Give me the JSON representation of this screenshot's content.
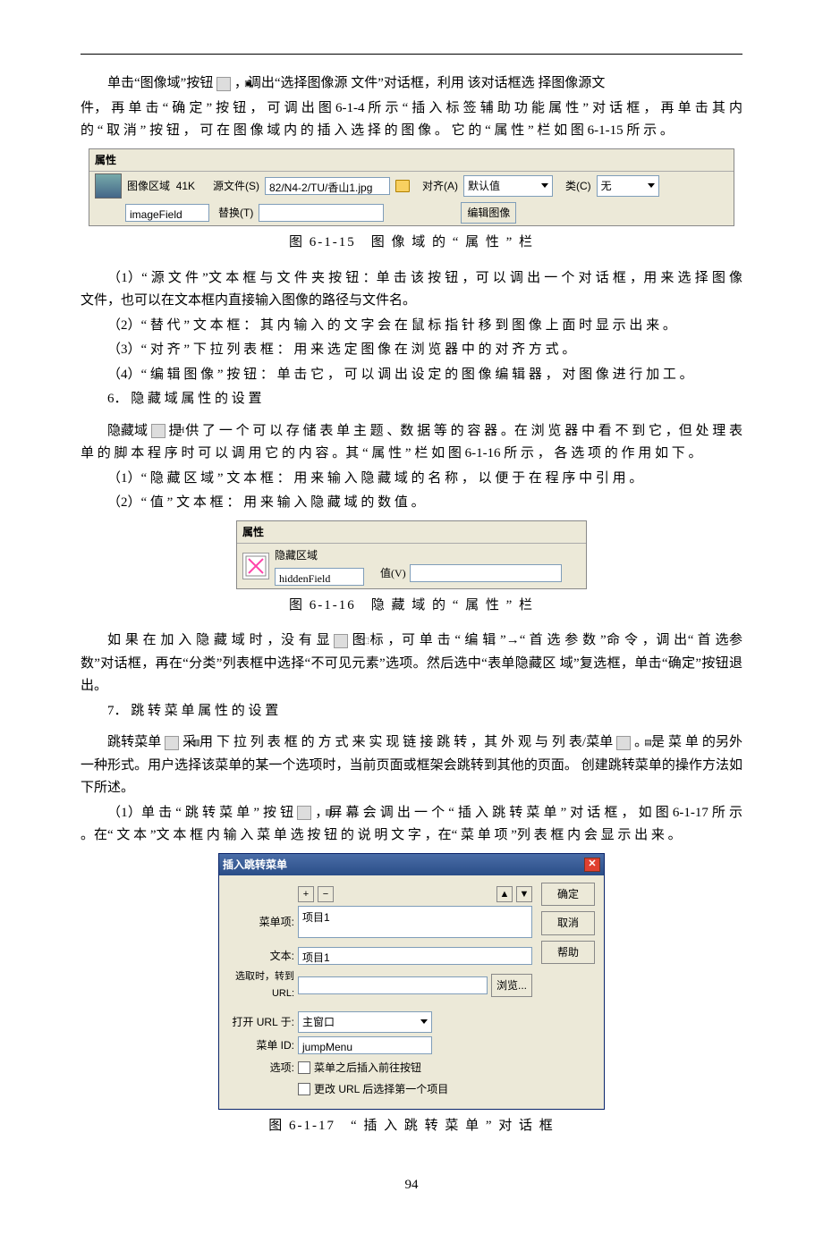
{
  "para1a": "单击“图像域”按钮",
  "para1b": "，调出“选择图像源 文件”对话框，利用 该对话框选 择图像源文",
  "para1c": "件， 再 单 击 “ 确 定 ” 按 钮 ， 可 调 出 图 6-1-4 所 示 “ 插 入 标 签 辅 助 功 能 属 性 ” 对 话 框 ， 再 单 击 其 内 的 “ 取 消 ” 按 钮 ， 可 在 图 像 域 内 的 插 入 选 择 的 图 像 。 它 的 “ 属 性 ” 栏 如 图 6-1-15 所 示 。",
  "panel15": {
    "tab": "属性",
    "label_area": "图像区域",
    "size": "41K",
    "src_label": "源文件(S)",
    "src_value": "82/N4-2/TU/香山1.jpg",
    "align_label": "对齐(A)",
    "align_value": "默认值",
    "class_label": "类(C)",
    "class_value": "无",
    "name_value": "imageField",
    "alt_label": "替换(T)",
    "edit_img_btn": "编辑图像"
  },
  "caption15": "图 6-1-15　图 像 域 的 “ 属 性 ” 栏",
  "para2": "（1）“ 源 文 件 ”文 本 框 与 文 件 夹 按 钮 ：单 击 该 按 钮 ，可 以 调 出 一 个 对 话 框 ，用 来 选 择 图 像 文件，也可以在文本框内直接输入图像的路径与文件名。",
  "para3": "（2）“ 替 代 ” 文 本 框 ： 其 内 输 入 的 文 字 会 在 鼠 标 指 针 移 到 图 像 上 面 时 显 示 出 来 。",
  "para4": "（3）“ 对 齐 ” 下 拉 列 表 框 ： 用 来 选 定 图 像 在 浏 览 器 中 的 对 齐 方 式 。",
  "para5": "（4）“ 编 辑 图 像 ” 按 钮 ： 单 击 它 ， 可 以 调 出 设 定 的 图 像 编 辑 器 ， 对 图 像 进 行 加 工 。",
  "sec6": "6． 隐 藏 域 属 性 的 设 置",
  "para6a": "隐藏域",
  "para6b": "提 供 了 一 个 可 以 存 储 表 单 主 题 、数 据 等 的 容 器 。在 浏 览 器 中 看 不 到 它 ，但 处 理 表 单 的 脚 本 程 序 时 可 以 调 用 它 的 内 容 。其 “ 属 性 ” 栏 如 图 6-1-16 所 示 ， 各 选 项 的 作 用 如 下 。",
  "para7": "（1）“ 隐 藏 区 域 ” 文 本 框 ： 用 来 输 入 隐 藏 域 的 名 称 ， 以 便 于 在 程 序 中 引 用 。",
  "para8": "（2）“ 值 ” 文 本 框 ： 用 来 输 入 隐 藏 域 的 数 值 。",
  "panel16": {
    "tab": "属性",
    "label": "隐藏区域",
    "name_value": "hiddenField",
    "val_label": "值(V)"
  },
  "caption16": "图 6-1-16　隐 藏 域 的 “ 属 性 ” 栏",
  "para9a": "如 果 在 加 入 隐 藏 域 时 ，没 有 显",
  "para9b": "图 标 ，可 单 击 “ 编 辑 ”→“ 首 选 参 数 ”命 令 ，调 出“ 首 选参数”对话框，再在“分类”列表框中选择“不可见元素”选项。然后选中“表单隐藏区 域”复选框，单击“确定”按钮退出。",
  "sec7": "7． 跳 转 菜 单 属 性 的 设 置",
  "para10a": "跳转菜单",
  "para10b": "采 用 下 拉 列 表 框 的 方 式 来 实 现 链 接 跳 转 ，其 外 观 与 列 表/菜单",
  "para10c": "。 是 菜 单 的另外一种形式。用户选择该菜单的某一个选项时，当前页面或框架会跳转到其他的页面。 创建跳转菜单的操作方法如下所述。",
  "para11a": "（1）单 击 “ 跳 转 菜 单 ” 按 钮",
  "para11b": "，屏 幕 会 调 出 一 个 “ 插 入 跳 转 菜 单 ” 对 话 框 ， 如 图 6-1-17 所 示 。在“ 文 本 ”文 本 框 内 输 入 菜 单 选 按 钮 的 说 明 文 字 ，在“ 菜 单 项 ”列 表 框 内 会 显 示 出 来 。",
  "dialog17": {
    "title": "插入跳转菜单",
    "ok": "确定",
    "cancel": "取消",
    "help": "帮助",
    "menu_items_label": "菜单项:",
    "item1": "项目1",
    "text_label": "文本:",
    "text_value": "项目1",
    "url_label": "选取时，转到 URL:",
    "browse": "浏览...",
    "open_label": "打开 URL 于:",
    "open_value": "主窗口",
    "menu_id_label": "菜单 ID:",
    "menu_id_value": "jumpMenu",
    "options_label": "选项:",
    "opt1": "菜单之后插入前往按钮",
    "opt2": "更改 URL 后选择第一个项目"
  },
  "caption17": "图 6-1-17　“ 插 入 跳 转 菜 单 ” 对 话 框",
  "page_num": "94"
}
